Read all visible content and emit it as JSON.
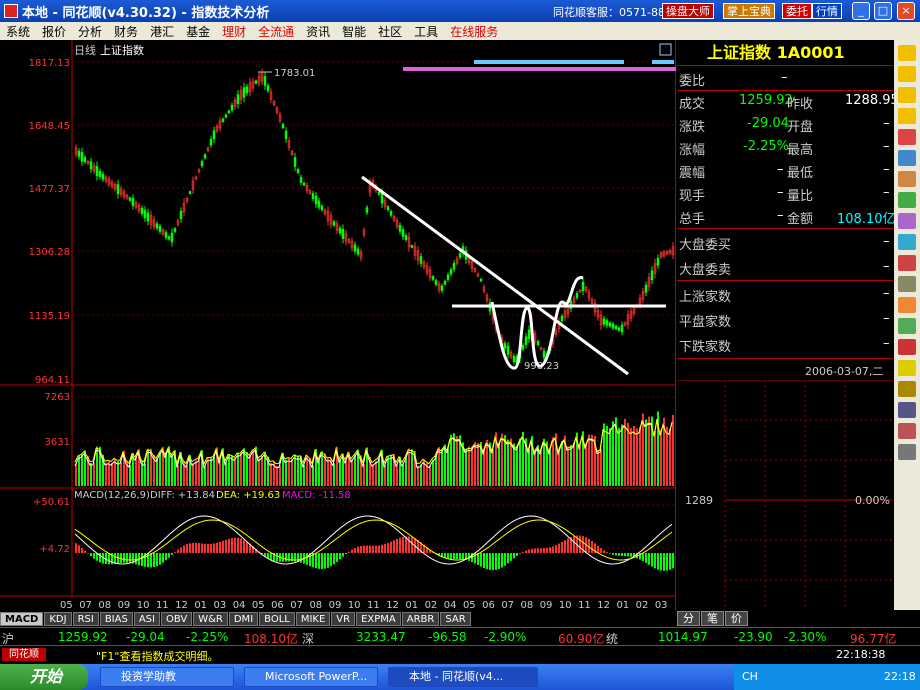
{
  "window": {
    "title": "本地 - 同花顺(v4.30.32) - 指数技术分析",
    "hotline": "同花顺客服：0571-88930898",
    "title_buttons": [
      "操盘大师",
      "掌上宝典",
      "委托",
      "行情"
    ],
    "controls": [
      "_",
      "□",
      "×"
    ]
  },
  "menu": [
    "系统",
    "报价",
    "分析",
    "财务",
    "港汇",
    "基金",
    "理财",
    "全流通",
    "资讯",
    "智能",
    "社区",
    "工具",
    "在线服务"
  ],
  "chart": {
    "period": "日线",
    "name": "上证指数",
    "price_ticks": [
      "1817.13",
      "1648.45",
      "1477.37",
      "1306.28",
      "1135.19",
      "964.11"
    ],
    "high_label": "1783.01",
    "low_label": "998.23",
    "vol_ticks": [
      "7263",
      "3631"
    ],
    "macd_title": "MACD(12,26,9)",
    "macd_diff": "DIFF: +13.84",
    "macd_dea": "DEA: +19.63",
    "macd_val": "MACD: -11.58",
    "macd_ticks": [
      "+50.61",
      "+4.72"
    ],
    "x_labels": [
      "05",
      "07",
      "08",
      "09",
      "10",
      "11",
      "12",
      "01",
      "03",
      "04",
      "05",
      "06",
      "07",
      "08",
      "09",
      "10",
      "11",
      "12",
      "01",
      "02",
      "04",
      "05",
      "06",
      "07",
      "08",
      "09",
      "10",
      "11",
      "12",
      "01",
      "02",
      "03"
    ]
  },
  "indicator_tabs": [
    "MACD",
    "KDJ",
    "RSI",
    "BIAS",
    "ASI",
    "OBV",
    "W&R",
    "DMI",
    "BOLL",
    "MIKE",
    "VR",
    "EXPMA",
    "ARBR",
    "SAR"
  ],
  "right_tabs": [
    "分",
    "笔",
    "价"
  ],
  "quote": {
    "title": "上证指数 1A0001",
    "wei_bi_label": "委比",
    "wei_bi": "–",
    "cj_label": "成交",
    "cj": "1259.92",
    "zs_label": "昨收",
    "zs": "1288.95",
    "zd_label": "涨跌",
    "zd": "-29.04",
    "kp_label": "开盘",
    "kp": "–",
    "zf_label": "涨幅",
    "zf": "-2.25%",
    "zg_label": "最高",
    "zg": "–",
    "zhenfu_label": "震幅",
    "zhenfu": "–",
    "zd2_label": "最低",
    "zd2": "–",
    "xs_label": "现手",
    "xs": "–",
    "lb_label": "量比",
    "lb": "–",
    "zs2_label": "总手",
    "zs2": "–",
    "je_label": "金额",
    "je": "108.10亿",
    "dpwm_label": "大盘委买",
    "dpwm": "–",
    "dpwmai_label": "大盘委卖",
    "dpwmai": "–",
    "sz_label": "上涨家数",
    "sz": "–",
    "pp_label": "平盘家数",
    "pp": "–",
    "xd_label": "下跌家数",
    "xd": "–",
    "date": "2006-03-07,二",
    "mini_price": "1289",
    "mini_pct": "0.00%"
  },
  "ticker": {
    "sh_label": "沪",
    "sh_price": "1259.92",
    "sh_chg": "-29.04",
    "sh_pct": "-2.25%",
    "sh_amt": "108.10亿",
    "sz_label": "深",
    "sz_price": "3233.47",
    "sz_chg": "-96.58",
    "sz_pct": "-2.90%",
    "sz_amt": "60.90亿",
    "ty_label": "统",
    "ty_price": "1014.97",
    "ty_chg": "-23.90",
    "ty_pct": "-2.30%",
    "ty_amt": "96.77亿"
  },
  "status": {
    "logo": "同花顺",
    "message": "\"F1\"查看指数成交明细。",
    "clock": "22:18:38"
  },
  "taskbar": {
    "start": "开始",
    "tasks": [
      "投资学助教",
      "Microsoft PowerP...",
      "本地 - 同花顺(v4..."
    ],
    "lang": "CH",
    "time": "22:18"
  },
  "colors": {
    "up": "#ff3232",
    "down": "#00ff00",
    "line": "#ffffff",
    "frame": "#b00000"
  }
}
